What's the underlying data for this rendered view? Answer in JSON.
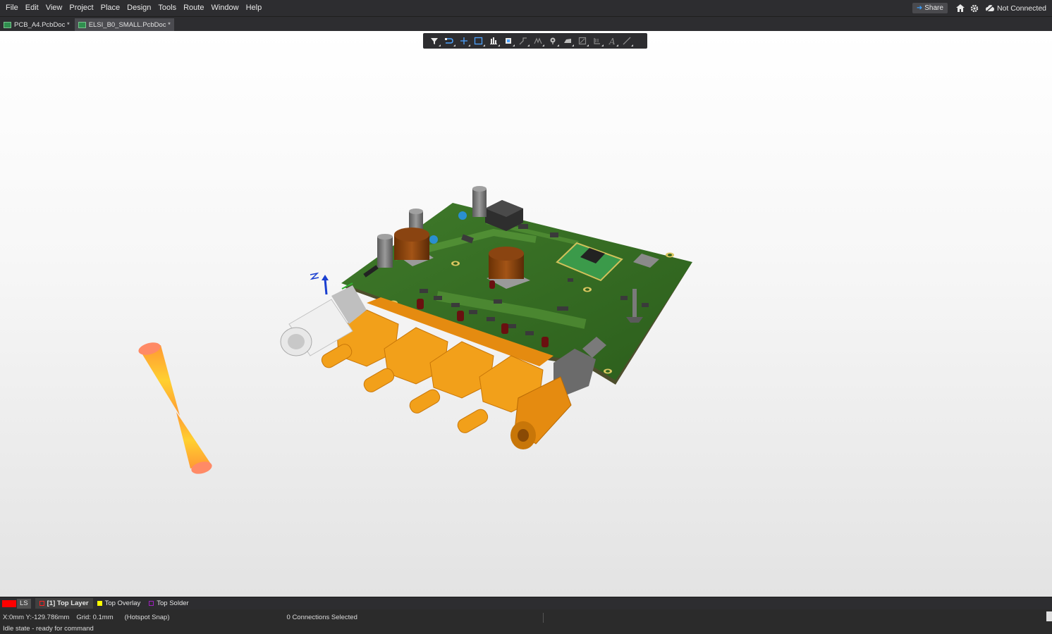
{
  "menu": {
    "items": [
      "File",
      "Edit",
      "View",
      "Project",
      "Place",
      "Design",
      "Tools",
      "Route",
      "Window",
      "Help"
    ]
  },
  "header": {
    "share_label": "Share",
    "connection_status": "Not Connected",
    "icons": [
      "home-icon",
      "gear-icon",
      "not-connected-icon"
    ]
  },
  "tabs": [
    {
      "label": "PCB_A4.PcbDoc *",
      "active": false
    },
    {
      "label": "ELSI_B0_SMALL.PcbDoc *",
      "active": true
    }
  ],
  "active_bar": {
    "tools": [
      "filter-icon",
      "route-select-icon",
      "cross-probe-icon",
      "select-rect-icon",
      "align-icon",
      "component-icon",
      "route-track-icon",
      "multi-route-icon",
      "place-via-icon",
      "polygon-icon",
      "region-icon",
      "dimension-icon",
      "text-icon",
      "line-icon"
    ]
  },
  "layers": {
    "ls_label": "LS",
    "items": [
      {
        "label": "[1] Top Layer",
        "color": "#ff2020",
        "active": true
      },
      {
        "label": "Top Overlay",
        "color": "#ffff00",
        "active": false
      },
      {
        "label": "Top Solder",
        "color": "#a020c0",
        "active": false
      }
    ]
  },
  "status": {
    "coords": "X:0mm Y:-129.786mm",
    "grid": "Grid: 0.1mm",
    "snap": "(Hotspot Snap)",
    "selection": "0 Connections Selected",
    "command": "Idle state - ready for command"
  }
}
